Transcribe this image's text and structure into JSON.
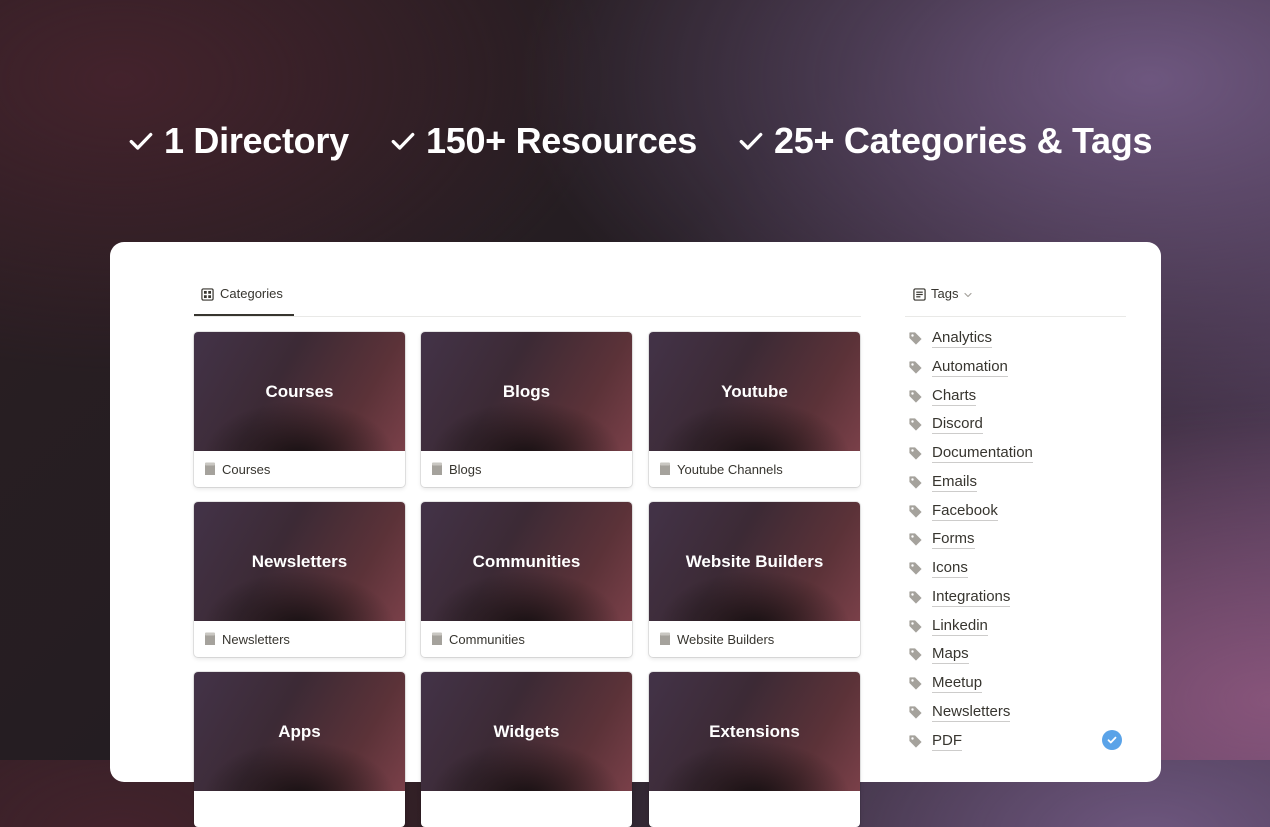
{
  "features": [
    {
      "icon": "check-icon",
      "label": "1 Directory"
    },
    {
      "icon": "check-icon",
      "label": "150+ Resources"
    },
    {
      "icon": "check-icon",
      "label": "25+ Categories & Tags"
    }
  ],
  "categories_view": {
    "tab_icon": "gallery-icon",
    "tab_label": "Categories",
    "cards": [
      {
        "cover_title": "Courses",
        "page_title": "Courses"
      },
      {
        "cover_title": "Blogs",
        "page_title": "Blogs"
      },
      {
        "cover_title": "Youtube",
        "page_title": "Youtube Channels"
      },
      {
        "cover_title": "Newsletters",
        "page_title": "Newsletters"
      },
      {
        "cover_title": "Communities",
        "page_title": "Communities"
      },
      {
        "cover_title": "Website Builders",
        "page_title": "Website Builders"
      },
      {
        "cover_title": "Apps",
        "page_title": ""
      },
      {
        "cover_title": "Widgets",
        "page_title": ""
      },
      {
        "cover_title": "Extensions",
        "page_title": ""
      }
    ]
  },
  "tags_view": {
    "tab_icon": "list-icon",
    "tab_label": "Tags",
    "items": [
      "Analytics",
      "Automation",
      "Charts",
      "Discord",
      "Documentation",
      "Emails",
      "Facebook",
      "Forms",
      "Icons",
      "Integrations",
      "Linkedin",
      "Maps",
      "Meetup",
      "Newsletters",
      "PDF"
    ]
  },
  "colors": {
    "accent_check": "#5aa3e8",
    "text": "#37352f",
    "tag_icon": "#a5a29c"
  }
}
